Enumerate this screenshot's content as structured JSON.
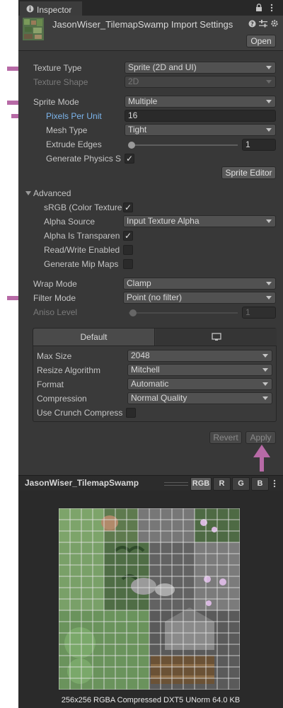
{
  "window": {
    "tab_title": "Inspector",
    "asset_title": "JasonWiser_TilemapSwamp Import Settings",
    "open_button": "Open",
    "icons": [
      "info-icon",
      "lock-icon",
      "more-icon",
      "help-icon",
      "presets-icon",
      "settings-icon"
    ]
  },
  "fields": {
    "texture_type": {
      "label": "Texture Type",
      "value": "Sprite (2D and UI)"
    },
    "texture_shape": {
      "label": "Texture Shape",
      "value": "2D"
    },
    "sprite_mode": {
      "label": "Sprite Mode",
      "value": "Multiple"
    },
    "pixels_per_unit": {
      "label": "Pixels Per Unit",
      "value": "16"
    },
    "mesh_type": {
      "label": "Mesh Type",
      "value": "Tight"
    },
    "extrude_edges": {
      "label": "Extrude Edges",
      "value": "1"
    },
    "generate_physics": {
      "label": "Generate Physics S",
      "checked": true
    },
    "sprite_editor_button": "Sprite Editor"
  },
  "advanced": {
    "header": "Advanced",
    "srgb": {
      "label": "sRGB (Color Texture",
      "checked": true
    },
    "alpha_source": {
      "label": "Alpha Source",
      "value": "Input Texture Alpha"
    },
    "alpha_transparency": {
      "label": "Alpha Is Transparen",
      "checked": true
    },
    "read_write": {
      "label": "Read/Write Enabled",
      "checked": false
    },
    "mip_maps": {
      "label": "Generate Mip Maps",
      "checked": false
    }
  },
  "wrap_filter": {
    "wrap_mode": {
      "label": "Wrap Mode",
      "value": "Clamp"
    },
    "filter_mode": {
      "label": "Filter Mode",
      "value": "Point (no filter)"
    },
    "aniso_level": {
      "label": "Aniso Level",
      "value": "1"
    }
  },
  "platform": {
    "tab_default": "Default",
    "tab_standalone_icon": "monitor-icon",
    "max_size": {
      "label": "Max Size",
      "value": "2048"
    },
    "resize_algorithm": {
      "label": "Resize Algorithm",
      "value": "Mitchell"
    },
    "format": {
      "label": "Format",
      "value": "Automatic"
    },
    "compression": {
      "label": "Compression",
      "value": "Normal Quality"
    },
    "crunch": {
      "label": "Use Crunch Compress",
      "checked": false
    }
  },
  "actions": {
    "revert": "Revert",
    "apply": "Apply"
  },
  "preview": {
    "title": "JasonWiser_TilemapSwamp",
    "channels": [
      "RGB",
      "R",
      "G",
      "B"
    ],
    "active_channel": "RGB",
    "info": "256x256  RGBA Compressed DXT5 UNorm  64.0 KB"
  },
  "colors": {
    "annotation_arrow": "#b76aa6",
    "link_label": "#7cb5ec"
  }
}
